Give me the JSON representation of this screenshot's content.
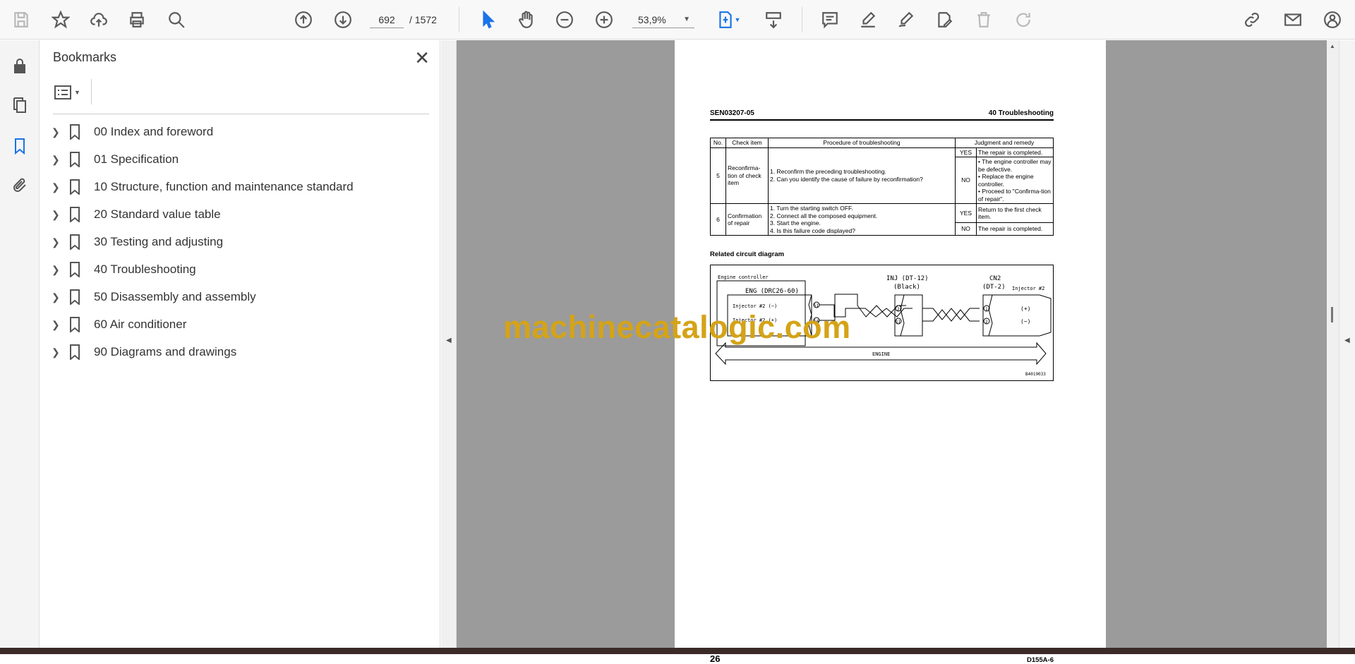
{
  "toolbar": {
    "page_current": "692",
    "page_total": "/ 1572",
    "zoom": "53,9%"
  },
  "bookmarks": {
    "title": "Bookmarks",
    "items": [
      {
        "label": "00 Index and foreword"
      },
      {
        "label": "01 Specification"
      },
      {
        "label": "10 Structure, function and maintenance standard"
      },
      {
        "label": "20 Standard value table"
      },
      {
        "label": "30 Testing and adjusting"
      },
      {
        "label": "40 Troubleshooting"
      },
      {
        "label": "50 Disassembly and assembly"
      },
      {
        "label": "60 Air conditioner"
      },
      {
        "label": "90 Diagrams and drawings"
      }
    ]
  },
  "document": {
    "header_left": "SEN03207-05",
    "header_right": "40 Troubleshooting",
    "table": {
      "headers": [
        "No.",
        "Check item",
        "Procedure of troubleshooting",
        "Judgment and remedy"
      ],
      "rows": [
        {
          "no": "5",
          "item": "Reconfirma-tion of check item",
          "steps": [
            "1.  Reconfirm the preceding troubleshooting.",
            "2.  Can you identify the cause of failure by reconfirmation?"
          ],
          "yes": "YES",
          "yes_text": "The repair is completed.",
          "no_label": "NO",
          "no_text": [
            "• The engine controller may be defective.",
            "• Replace the engine controller.",
            "• Proceed to \"Confirma-tion of repair\"."
          ]
        },
        {
          "no": "6",
          "item": "Confirmation of repair",
          "steps": [
            "1.  Turn the starting switch OFF.",
            "2.  Connect all the composed equipment.",
            "3.  Start the engine.",
            "4.  Is this failure code displayed?"
          ],
          "yes": "YES",
          "yes_text": "Return to the first check item.",
          "no_label": "NO",
          "no_text": "The repair is completed."
        }
      ]
    },
    "related_title": "Related circuit diagram",
    "circuit": {
      "controller": "Engine controller",
      "eng": "ENG (DRC26-60)",
      "inj_minus": "Injector #2 (−)",
      "inj_plus": "Injector #2 (+)",
      "pin51": "51",
      "pin54": "54",
      "inj_conn": "INJ (DT-12)",
      "black": "(Black)",
      "pin2": "2",
      "pin11": "11",
      "cn2": "CN2",
      "dt2": "(DT-2)",
      "injector": "Injector #2",
      "pin_1": "1",
      "pin_2": "2",
      "plus": "(+)",
      "minus": "(−)",
      "engine": "ENGINE",
      "code": "B4019033"
    },
    "footer_left": "26",
    "footer_right": "D155A-6",
    "watermark": "machinecatalogic.com"
  }
}
